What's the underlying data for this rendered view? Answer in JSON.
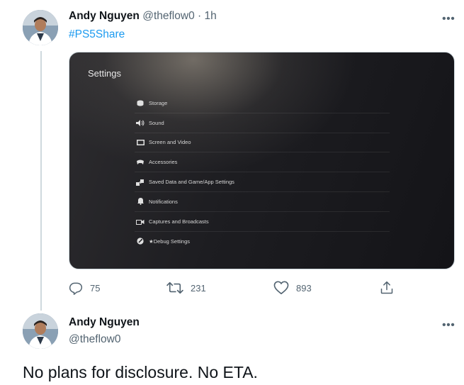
{
  "tweet1": {
    "author_name": "Andy Nguyen",
    "author_handle": "@theflow0",
    "separator": "·",
    "time": "1h",
    "hashtag": "#PS5Share",
    "more_icon": "more-horizontal-icon",
    "media": {
      "screen_title": "Settings",
      "menu_items": [
        {
          "label": "Storage",
          "icon": "storage-icon"
        },
        {
          "label": "Sound",
          "icon": "sound-icon"
        },
        {
          "label": "Screen and Video",
          "icon": "screen-icon"
        },
        {
          "label": "Accessories",
          "icon": "accessories-icon"
        },
        {
          "label": "Saved Data and Game/App Settings",
          "icon": "saved-data-icon"
        },
        {
          "label": "Notifications",
          "icon": "notifications-icon"
        },
        {
          "label": "Captures and Broadcasts",
          "icon": "captures-icon"
        },
        {
          "label": "★Debug Settings",
          "icon": "debug-icon"
        }
      ]
    },
    "actions": {
      "replies": "75",
      "retweets": "231",
      "likes": "893"
    }
  },
  "tweet2": {
    "author_name": "Andy Nguyen",
    "author_handle": "@theflow0",
    "text": "No plans for disclosure. No ETA.",
    "more_icon": "more-horizontal-icon"
  },
  "colors": {
    "link": "#1d9bf0",
    "secondary_text": "#536471",
    "thread_line": "#cfd9de"
  }
}
